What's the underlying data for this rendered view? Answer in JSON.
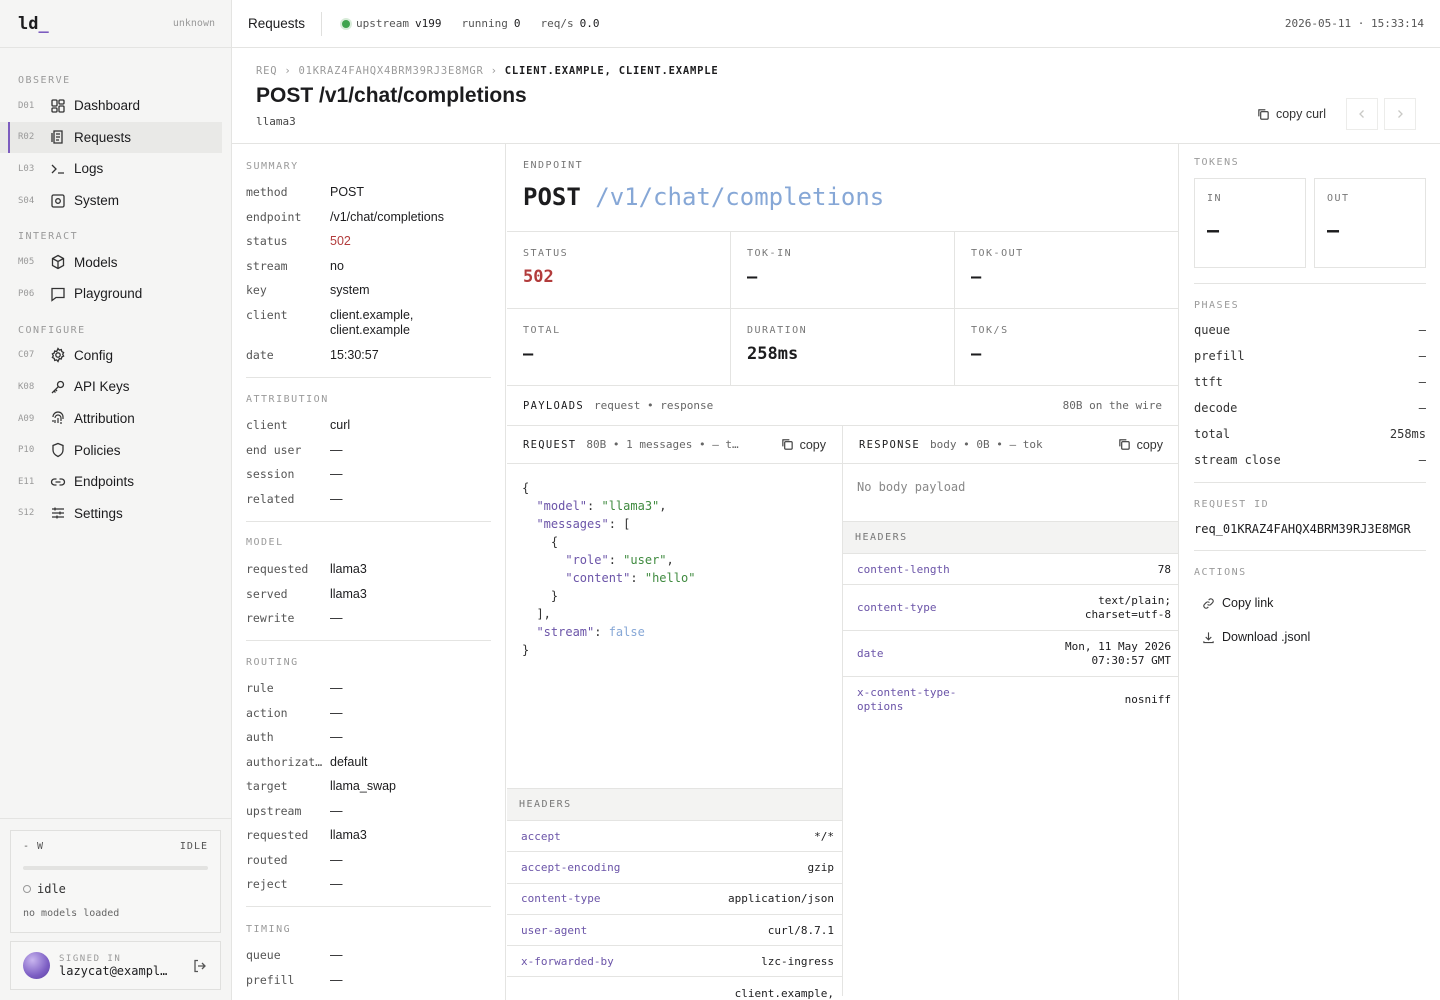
{
  "brand": {
    "logo": "ld",
    "cursor": "_",
    "status": "unknown"
  },
  "sidebar": {
    "sections": [
      {
        "title": "OBSERVE",
        "items": [
          {
            "code": "D01",
            "label": "Dashboard",
            "icon": "dashboard-icon"
          },
          {
            "code": "R02",
            "label": "Requests",
            "icon": "requests-icon",
            "active": true
          },
          {
            "code": "L03",
            "label": "Logs",
            "icon": "terminal-icon"
          },
          {
            "code": "S04",
            "label": "System",
            "icon": "system-icon"
          }
        ]
      },
      {
        "title": "INTERACT",
        "items": [
          {
            "code": "M05",
            "label": "Models",
            "icon": "models-icon"
          },
          {
            "code": "P06",
            "label": "Playground",
            "icon": "chat-icon"
          }
        ]
      },
      {
        "title": "CONFIGURE",
        "items": [
          {
            "code": "C07",
            "label": "Config",
            "icon": "gear-icon"
          },
          {
            "code": "K08",
            "label": "API Keys",
            "icon": "key-icon"
          },
          {
            "code": "A09",
            "label": "Attribution",
            "icon": "fingerprint-icon"
          },
          {
            "code": "P10",
            "label": "Policies",
            "icon": "shield-icon"
          },
          {
            "code": "E11",
            "label": "Endpoints",
            "icon": "link-icon"
          },
          {
            "code": "S12",
            "label": "Settings",
            "icon": "sliders-icon"
          }
        ]
      }
    ],
    "worker": {
      "name": "- W",
      "badge": "IDLE",
      "state": "idle",
      "sub": "no models loaded"
    },
    "user": {
      "label": "SIGNED IN",
      "email": "lazycat@exampl…"
    }
  },
  "topbar": {
    "title": "Requests",
    "upstream_label": "upstream",
    "upstream_value": "v199",
    "running_label": "running",
    "running_value": "0",
    "reqs_label": "req/s",
    "reqs_value": "0.0",
    "time": "2026-05-11 · 15:33:14"
  },
  "header": {
    "crumb_root": "REQ",
    "crumb_id": "01KRAZ4FAHQX4BRM39RJ3E8MGR",
    "crumb_current": "CLIENT.EXAMPLE, CLIENT.EXAMPLE",
    "title": "POST /v1/chat/completions",
    "subtitle": "llama3",
    "copy_curl": "copy curl"
  },
  "summary": {
    "title": "SUMMARY",
    "rows": [
      {
        "k": "method",
        "v": "POST"
      },
      {
        "k": "endpoint",
        "v": "/v1/chat/completions"
      },
      {
        "k": "status",
        "v": "502"
      },
      {
        "k": "stream",
        "v": "no"
      },
      {
        "k": "key",
        "v": "system"
      },
      {
        "k": "client",
        "v": "client.example, client.example"
      },
      {
        "k": "date",
        "v": "15:30:57"
      }
    ]
  },
  "attribution": {
    "title": "ATTRIBUTION",
    "rows": [
      {
        "k": "client",
        "v": "curl"
      },
      {
        "k": "end user",
        "v": "—"
      },
      {
        "k": "session",
        "v": "—"
      },
      {
        "k": "related",
        "v": "—"
      }
    ]
  },
  "model": {
    "title": "MODEL",
    "rows": [
      {
        "k": "requested",
        "v": "llama3"
      },
      {
        "k": "served",
        "v": "llama3"
      },
      {
        "k": "rewrite",
        "v": "—"
      }
    ]
  },
  "routing": {
    "title": "ROUTING",
    "rows": [
      {
        "k": "rule",
        "v": "—"
      },
      {
        "k": "action",
        "v": "—"
      },
      {
        "k": "auth",
        "v": "—"
      },
      {
        "k": "authorizat…",
        "v": "default"
      },
      {
        "k": "target",
        "v": "llama_swap"
      },
      {
        "k": "upstream",
        "v": "—"
      },
      {
        "k": "requested",
        "v": "llama3"
      },
      {
        "k": "routed",
        "v": "—"
      },
      {
        "k": "reject",
        "v": "—"
      }
    ]
  },
  "timing": {
    "title": "TIMING",
    "rows": [
      {
        "k": "queue",
        "v": "—"
      },
      {
        "k": "prefill",
        "v": "—"
      }
    ]
  },
  "endpoint": {
    "label": "ENDPOINT",
    "method": "POST",
    "path": "/v1/chat/completions"
  },
  "stats": [
    {
      "label": "STATUS",
      "value": "502",
      "error": true
    },
    {
      "label": "TOK-IN",
      "value": "—"
    },
    {
      "label": "TOK-OUT",
      "value": "—"
    },
    {
      "label": "TOTAL",
      "value": "—"
    },
    {
      "label": "DURATION",
      "value": "258ms"
    },
    {
      "label": "TOK/S",
      "value": "—"
    }
  ],
  "payloads": {
    "title": "PAYLOADS",
    "sub": "request • response",
    "wire": "80B on the wire"
  },
  "request": {
    "title": "REQUEST",
    "meta": "80B • 1 messages • — t…",
    "copy": "copy",
    "headers_title": "HEADERS",
    "headers": [
      {
        "k": "accept",
        "v": "*/*"
      },
      {
        "k": "accept-encoding",
        "v": "gzip"
      },
      {
        "k": "content-type",
        "v": "application/json"
      },
      {
        "k": "user-agent",
        "v": "curl/8.7.1"
      },
      {
        "k": "x-forwarded-by",
        "v": "lzc-ingress"
      },
      {
        "k": "",
        "v": "client.example,"
      }
    ]
  },
  "response": {
    "title": "RESPONSE",
    "meta": "body • 0B • — tok",
    "copy": "copy",
    "no_body": "No body payload",
    "headers_title": "HEADERS",
    "headers": [
      {
        "k": "content-length",
        "v": "78"
      },
      {
        "k": "content-type",
        "v": "text/plain;\ncharset=utf-8"
      },
      {
        "k": "date",
        "v": "Mon, 11 May 2026\n07:30:57 GMT"
      },
      {
        "k": "x-content-type-\noptions",
        "v": "nosniff"
      }
    ]
  },
  "tokens": {
    "title": "TOKENS",
    "in_label": "IN",
    "in_value": "—",
    "out_label": "OUT",
    "out_value": "—"
  },
  "phases": {
    "title": "PHASES",
    "rows": [
      {
        "k": "queue",
        "v": "—"
      },
      {
        "k": "prefill",
        "v": "—"
      },
      {
        "k": "ttft",
        "v": "—"
      },
      {
        "k": "decode",
        "v": "—"
      },
      {
        "k": "total",
        "v": "258ms"
      },
      {
        "k": "stream close",
        "v": "—"
      }
    ]
  },
  "request_id": {
    "title": "REQUEST ID",
    "value": "req_01KRAZ4FAHQX4BRM39RJ3E8MGR"
  },
  "actions": {
    "title": "ACTIONS",
    "copy_link": "Copy link",
    "download": "Download .jsonl"
  },
  "colors": {
    "accent": "#7c5cbf",
    "error": "#b23c3c",
    "ok": "#3fa34d",
    "path": "#86a7d6"
  }
}
